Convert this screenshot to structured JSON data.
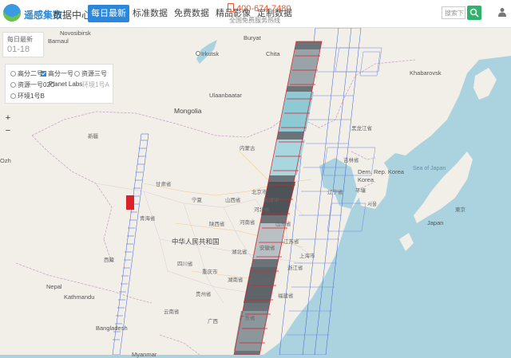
{
  "header": {
    "logo_text": "遥感集市",
    "center_menu": "数据中心",
    "tabs": [
      "每日最新",
      "标准数据",
      "免费数据",
      "精品影像",
      "定制数据"
    ],
    "active_tab_index": 0,
    "phone": "400-674-7480",
    "slogan": "全国免费服务热线",
    "search_placeholder": "搜索下",
    "accent_color": "#2b87da"
  },
  "date_panel": {
    "label": "每日最新",
    "value": "01-18"
  },
  "satellites": [
    {
      "label": "高分二号",
      "type": "radio",
      "state": "off"
    },
    {
      "label": "高分一号",
      "type": "checkbox",
      "state": "checked"
    },
    {
      "label": "资源三号",
      "type": "radio",
      "state": "off"
    },
    {
      "label": "资源一号02C",
      "type": "radio",
      "state": "off"
    },
    {
      "label": "Planet Labs",
      "type": "text",
      "state": "off"
    },
    {
      "label": "环境1号A",
      "type": "text",
      "state": "disabled"
    },
    {
      "label": "环境1号B",
      "type": "radio",
      "state": "off"
    }
  ],
  "map": {
    "zoom_in": "+",
    "zoom_out": "−",
    "labels": {
      "barnaul": "Barnaul",
      "novosibirsk": "Novosibirsk",
      "buryat": "Buryat",
      "chita": "Chita",
      "irkutsk": "Irkutsk",
      "ulaanbaatar": "Ulaanbaatar",
      "khabarovsk": "Khabarovsk",
      "mongolia": "Mongolia",
      "dem_rep_korea": "Dem. Rep. Korea",
      "korea": "Korea",
      "japan": "Japan",
      "sea_of_japan": "Sea of Japan",
      "china": "中华人民共和国",
      "nepal": "Nepal",
      "kathmandu": "Kathmandu",
      "bangladesh": "Bangladesh",
      "myanmar": "Myanmar",
      "uzb": "Ozh",
      "beijing": "北京市",
      "tianjin": "天津市",
      "xinjiang": "新疆",
      "gansu": "甘肃省",
      "qinghai": "青海省",
      "neimeng": "内蒙古",
      "shanxi": "山西省",
      "shaanxi": "陕西省",
      "henan": "河南省",
      "hubei": "湖北省",
      "sichuan": "四川省",
      "chongqing": "重庆市",
      "hunan": "湖南省",
      "jiangxi": "江西省",
      "zhejiang": "浙江省",
      "fujian": "福建省",
      "guangdong": "广东省",
      "guangxi": "广西",
      "guizhou": "贵州省",
      "yunnan": "云南省",
      "xizang": "西藏",
      "ningxia": "宁夏",
      "hebei": "河北省",
      "shandong": "山东省",
      "jiangsu": "江苏省",
      "anhui": "安徽省",
      "liaoning": "辽宁省",
      "jilin": "吉林省",
      "heilongjiang": "黑龙江省",
      "shanghai": "上海市",
      "pyongyang": "平壤",
      "seoul": "서울",
      "tokyo": "東京"
    }
  }
}
